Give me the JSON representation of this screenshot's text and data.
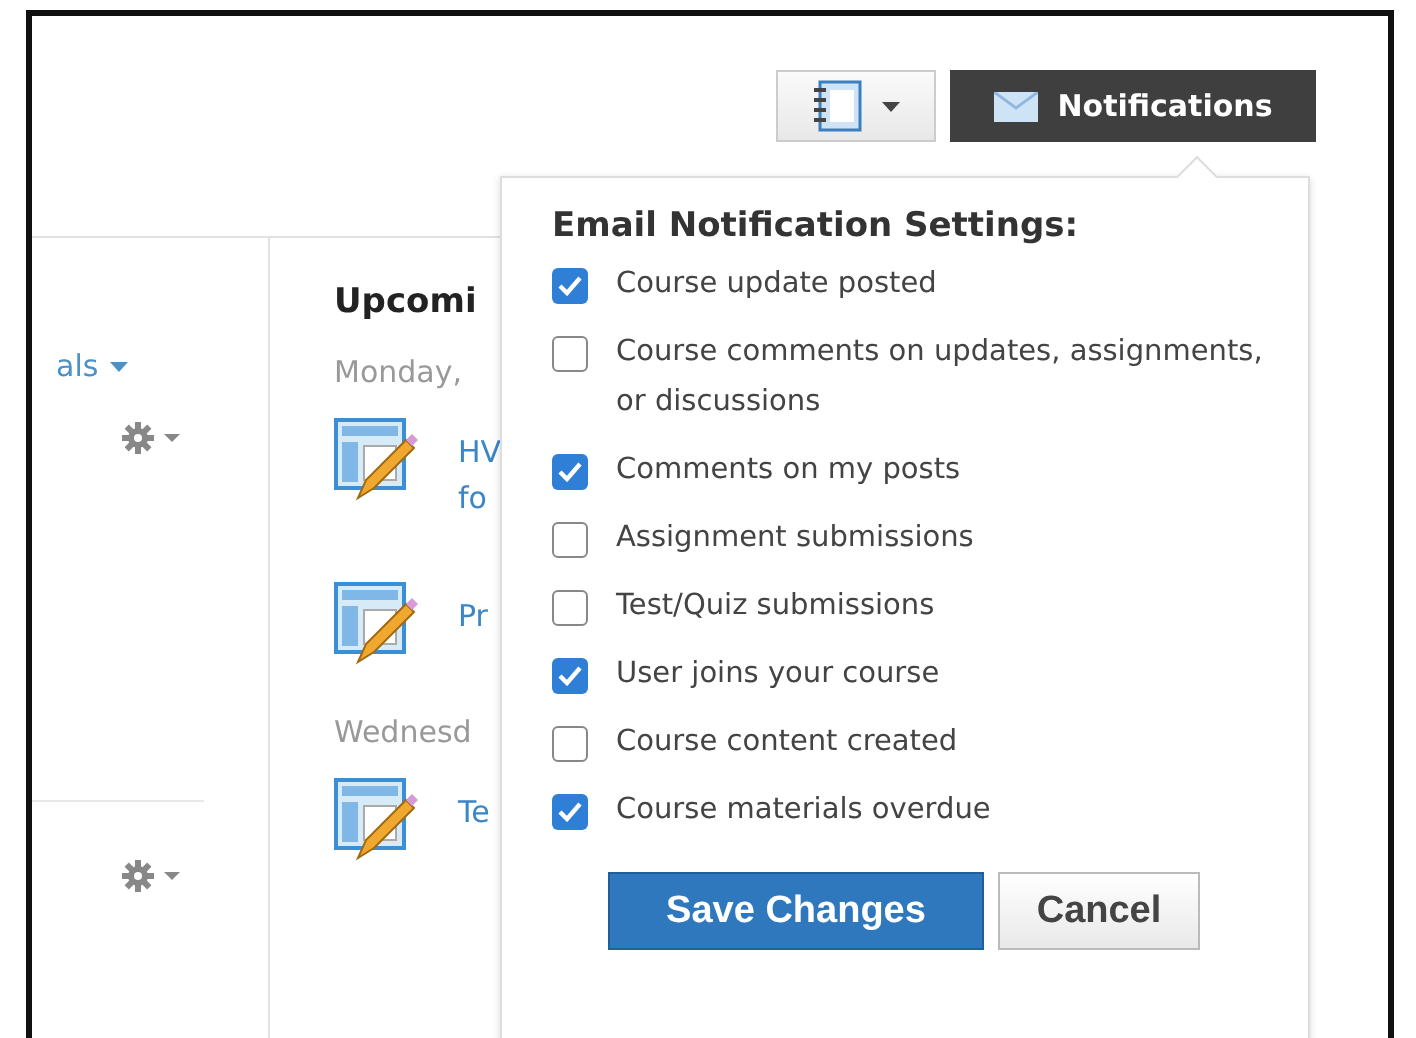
{
  "toolbar": {
    "notebook_button": {
      "kind": "dropdown"
    },
    "notifications_button": {
      "label": "Notifications"
    }
  },
  "left_panel": {
    "link": "als",
    "sections": [
      {
        "kind": "gear"
      },
      {
        "kind": "gear"
      }
    ]
  },
  "upcoming": {
    "title": "Upcomi",
    "groups": [
      {
        "day": "Monday,",
        "items": [
          {
            "lines": [
              "HV",
              "fo"
            ]
          },
          {
            "lines": [
              "Pr"
            ]
          }
        ]
      },
      {
        "day": "Wednesd",
        "items": [
          {
            "lines": [
              "Te"
            ]
          }
        ]
      }
    ]
  },
  "popup": {
    "title": "Email Notification Settings:",
    "options": [
      {
        "label": "Course update posted",
        "checked": true
      },
      {
        "label": "Course comments on updates, assignments, or discussions",
        "checked": false
      },
      {
        "label": "Comments on my posts",
        "checked": true
      },
      {
        "label": "Assignment submissions",
        "checked": false
      },
      {
        "label": "Test/Quiz submissions",
        "checked": false
      },
      {
        "label": "User joins your course",
        "checked": true
      },
      {
        "label": "Course content created",
        "checked": false
      },
      {
        "label": "Course materials overdue",
        "checked": true
      }
    ],
    "buttons": [
      {
        "label": "Save Changes",
        "kind": "primary"
      },
      {
        "label": "Cancel",
        "kind": "secondary"
      }
    ]
  }
}
